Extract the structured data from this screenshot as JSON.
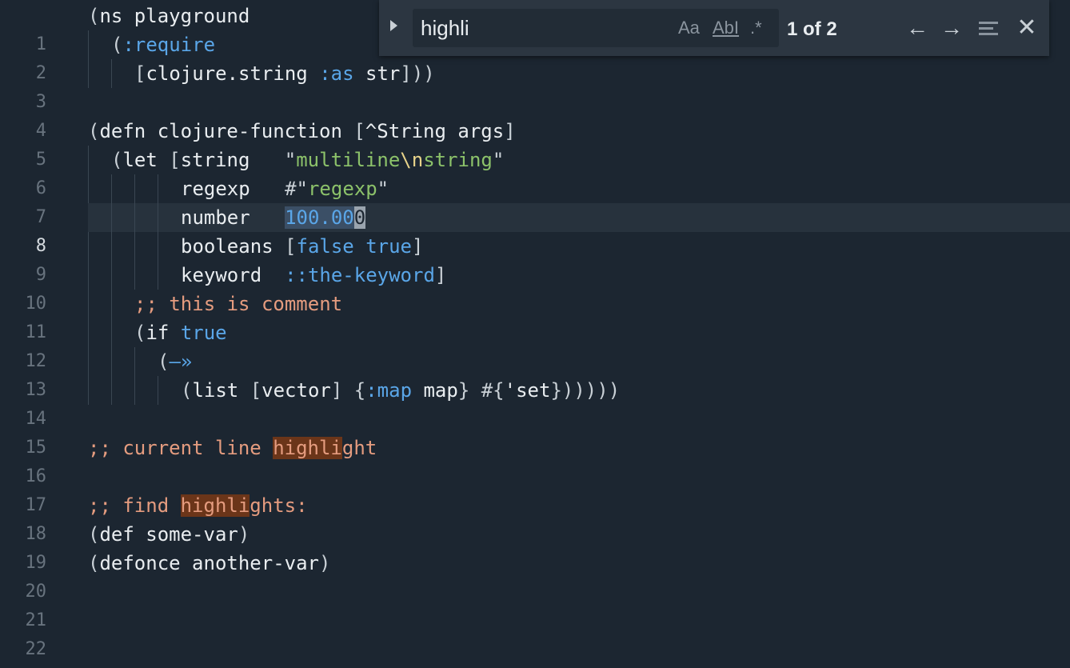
{
  "findbar": {
    "query": "highli",
    "match_case_label": "Aa",
    "whole_word_label": "AbI",
    "regex_label": ".*",
    "count": "1 of 2",
    "prev_icon": "arrow-left-icon",
    "next_icon": "arrow-right-icon",
    "select_all_icon": "lines-icon",
    "close_icon": "close-icon"
  },
  "editor": {
    "current_line": 8,
    "line_numbers": [
      "1",
      "2",
      "3",
      "4",
      "5",
      "6",
      "7",
      "8",
      "9",
      "10",
      "11",
      "12",
      "13",
      "14",
      "15",
      "16",
      "17",
      "18",
      "19",
      "20",
      "21",
      "22"
    ],
    "lines": {
      "l1": [
        "(",
        "ns playground"
      ],
      "l2": [
        "(",
        ":require"
      ],
      "l3": [
        "[",
        "clojure.string",
        ":as",
        "str",
        "]))"
      ],
      "l5": [
        "(",
        "defn clojure-function",
        "[",
        "^String args",
        "]"
      ],
      "l6": [
        "(",
        "let",
        "[",
        "string",
        "\"",
        "multiline",
        "\\n",
        "string",
        "\""
      ],
      "l7": [
        "regexp",
        "#\"",
        "regexp",
        "\""
      ],
      "l8": [
        "number",
        "100.00",
        "0"
      ],
      "l9": [
        "booleans",
        "[",
        "false",
        "true",
        "]"
      ],
      "l10": [
        "keyword",
        "::the-keyword",
        "]"
      ],
      "l11": [
        ";; this is comment"
      ],
      "l12": [
        "(",
        "if",
        "true"
      ],
      "l13": [
        "(",
        "—»"
      ],
      "l14": [
        "(",
        "list",
        "[",
        "vector",
        "]",
        "{",
        ":map",
        "map",
        "}",
        "#{",
        "'set",
        "}",
        ")))))"
      ],
      "l16": [
        ";; current line ",
        "highli",
        "ght"
      ],
      "l18": [
        ";; find ",
        "highli",
        "ghts:"
      ],
      "l19": [
        "(",
        "def some-var",
        ")"
      ],
      "l20": [
        "(",
        "defonce another-var",
        ")"
      ]
    }
  }
}
